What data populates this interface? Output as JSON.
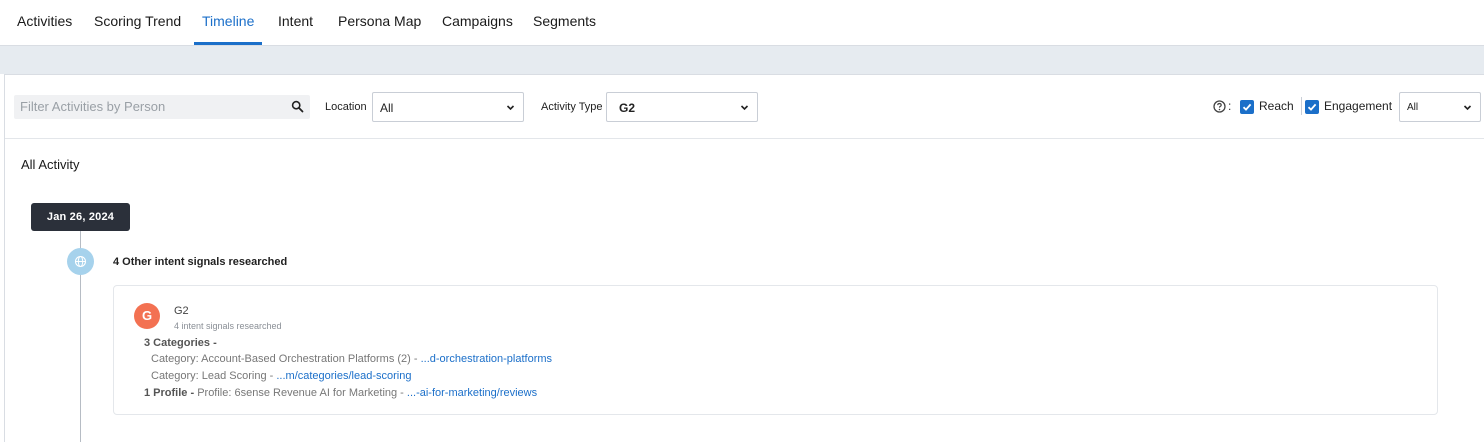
{
  "tabs": [
    {
      "label": "Activities"
    },
    {
      "label": "Scoring Trend"
    },
    {
      "label": "Timeline"
    },
    {
      "label": "Intent"
    },
    {
      "label": "Persona Map"
    },
    {
      "label": "Campaigns"
    },
    {
      "label": "Segments"
    }
  ],
  "active_tab": "Timeline",
  "filters": {
    "search_placeholder": "Filter Activities by Person",
    "location_label": "Location",
    "location_value": "All",
    "activity_type_label": "Activity Type",
    "activity_type_value": "G2",
    "colon": ":",
    "reach_label": "Reach",
    "engagement_label": "Engagement",
    "engagement_select_value": "All"
  },
  "section_title": "All Activity",
  "timeline": {
    "date": "Jan 26, 2024",
    "event_title": "4 Other intent signals researched",
    "card": {
      "source": "G2",
      "logo_text": "G",
      "subtitle": "4 intent signals researched",
      "categories_header": "3 Categories -",
      "category_1_text": "Category: Account-Based Orchestration Platforms (2) - ",
      "category_1_link": "...d-orchestration-platforms",
      "category_2_text": "Category: Lead Scoring - ",
      "category_2_link": "...m/categories/lead-scoring",
      "profile_header": "1 Profile - ",
      "profile_text": "Profile: 6sense Revenue AI for Marketing - ",
      "profile_link": "...-ai-for-marketing/reviews"
    }
  },
  "colors": {
    "accent": "#1b6fc9",
    "date_chip": "#2b303a",
    "node": "#a6d2ec",
    "g2_logo": "#f37152"
  }
}
